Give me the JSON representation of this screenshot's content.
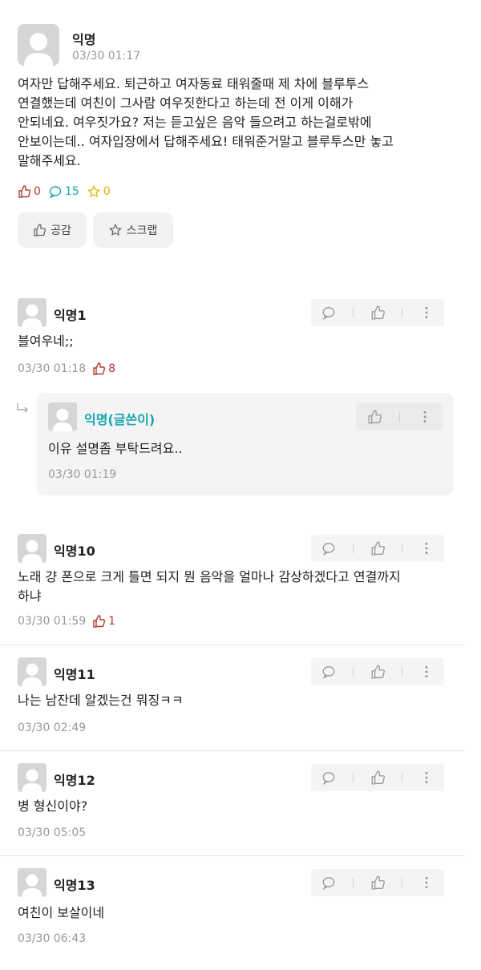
{
  "post": {
    "author": "익명",
    "time": "03/30 01:17",
    "body_lines": [
      "여자만 답해주세요. 퇴근하고 여자동료 태워줄때 제 차에 블루투스",
      "연결했는데 여친이 그사람 여우짓한다고 하는데 전 이게 이해가",
      "안되네요. 여우짓가요? 저는 듣고싶은 음악 들으려고 하는걸로밖에",
      "안보이는데.. 여자입장에서 답해주세요! 태워준거말고 블루투스만 놓고",
      "말해주세요."
    ],
    "likes": "0",
    "comments": "15",
    "scraps": "0",
    "like_button": "공감",
    "scrap_button": "스크랩"
  },
  "comments": [
    {
      "author": "익명1",
      "text": "블여우네;;",
      "time": "03/30 01:18",
      "likes": "8"
    },
    {
      "author": "익명10",
      "text_lines": [
        "노래 걍 폰으로 크게 틀면 되지 뭔 음악을 얼마나 감상하겠다고 연결까지",
        "하냐"
      ],
      "time": "03/30 01:59",
      "likes": "1"
    },
    {
      "author": "익명11",
      "text": "나는 남잔데 알겠는건 뭐징ㅋㅋ",
      "time": "03/30 02:49"
    },
    {
      "author": "익명12",
      "text": "병 형신이야?",
      "time": "03/30 05:05"
    },
    {
      "author": "익명13",
      "text": "여친이 보살이네",
      "time": "03/30 06:43"
    }
  ],
  "reply": {
    "author": "익명(글쓴이)",
    "text": "이유 설명좀 부탁드려요..",
    "time": "03/30 01:19"
  },
  "colors": {
    "like": "#b23a2a",
    "comment": "#17a5b3",
    "scrap": "#e0b400",
    "author": "#17a5b3"
  }
}
